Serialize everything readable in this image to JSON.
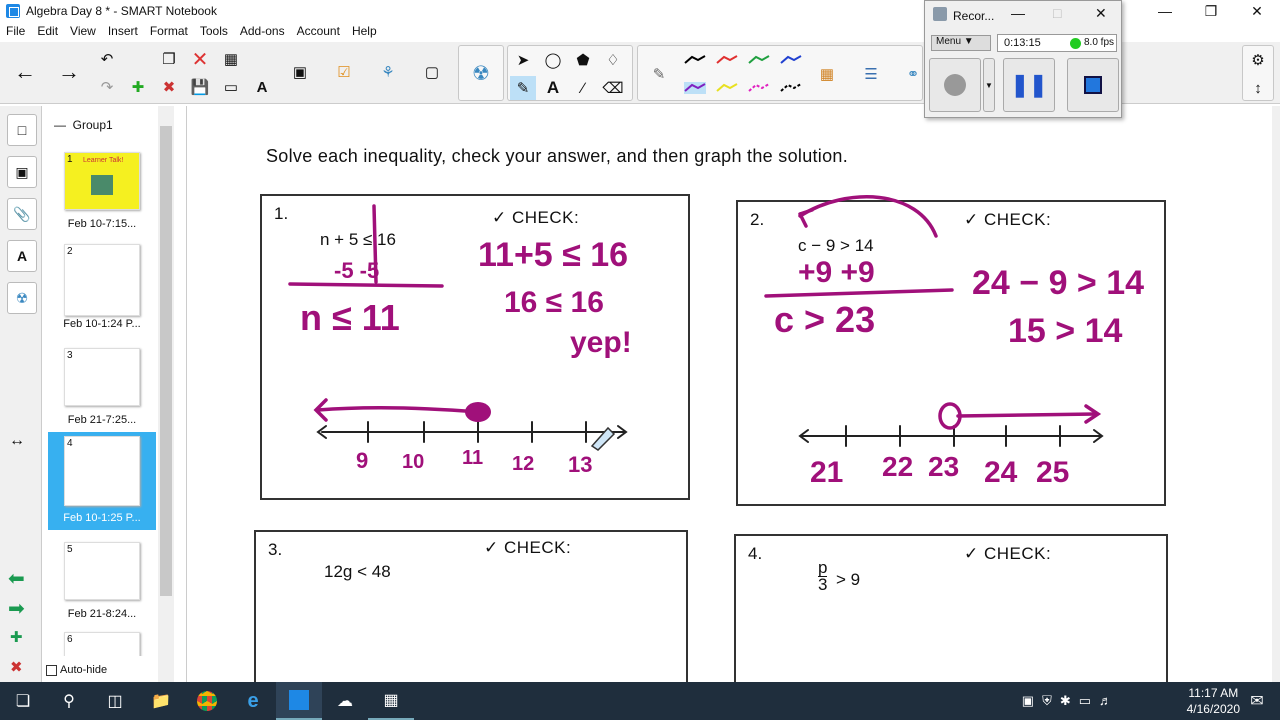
{
  "window": {
    "title": "Algebra Day 8 * - SMART Notebook",
    "min": "—",
    "restore": "❐",
    "close": "✕"
  },
  "menu": [
    "File",
    "Edit",
    "View",
    "Insert",
    "Format",
    "Tools",
    "Add-ons",
    "Account",
    "Help"
  ],
  "recorder": {
    "title": "Recor...",
    "menu_label": "Menu",
    "time": "0:13:15",
    "fps": "8.0 fps"
  },
  "sorter": {
    "group": "Group1",
    "pages": [
      {
        "num": "1",
        "caption": "Feb 10-7:15...",
        "thumb_title": "Learner Talk!"
      },
      {
        "num": "2",
        "caption": "Feb 10-1:24 P..."
      },
      {
        "num": "3",
        "caption": "Feb 21-7:25..."
      },
      {
        "num": "4",
        "caption": "Feb 10-1:25 P..."
      },
      {
        "num": "5",
        "caption": "Feb 21-8:24..."
      },
      {
        "num": "6",
        "caption": ""
      }
    ],
    "autohide": "Auto-hide"
  },
  "page": {
    "instruction": "Solve each inequality, check your answer, and then graph the solution.",
    "check_label": "✓ CHECK:",
    "problems": [
      {
        "num": "1.",
        "equation": "n + 5 ≤ 16"
      },
      {
        "num": "2.",
        "equation": "c − 9 > 14"
      },
      {
        "num": "3.",
        "equation": "12g < 48"
      },
      {
        "num": "4.",
        "equation_num": "p",
        "equation_den": "3",
        "equation_rest": "> 9"
      }
    ],
    "ink": {
      "p1_work_line1": "-5   -5",
      "p1_result": "n ≤ 11",
      "p1_check1": "11+5 ≤ 16",
      "p1_check2": "16 ≤ 16",
      "p1_check3": "yep!",
      "p1_ticks": [
        "9",
        "10",
        "11",
        "12",
        "13"
      ],
      "p2_work_line1": "+9  +9",
      "p2_result": "c > 23",
      "p2_check1": "24 − 9 > 14",
      "p2_check2": "15 > 14",
      "p2_ticks": [
        "21",
        "22",
        "23",
        "24",
        "25"
      ]
    }
  },
  "taskbar": {
    "time": "11:17 AM",
    "date": "4/16/2020"
  },
  "colors": {
    "ink": "#a0107a",
    "accent": "#37b0f0",
    "taskbar": "#1f2e3d"
  }
}
